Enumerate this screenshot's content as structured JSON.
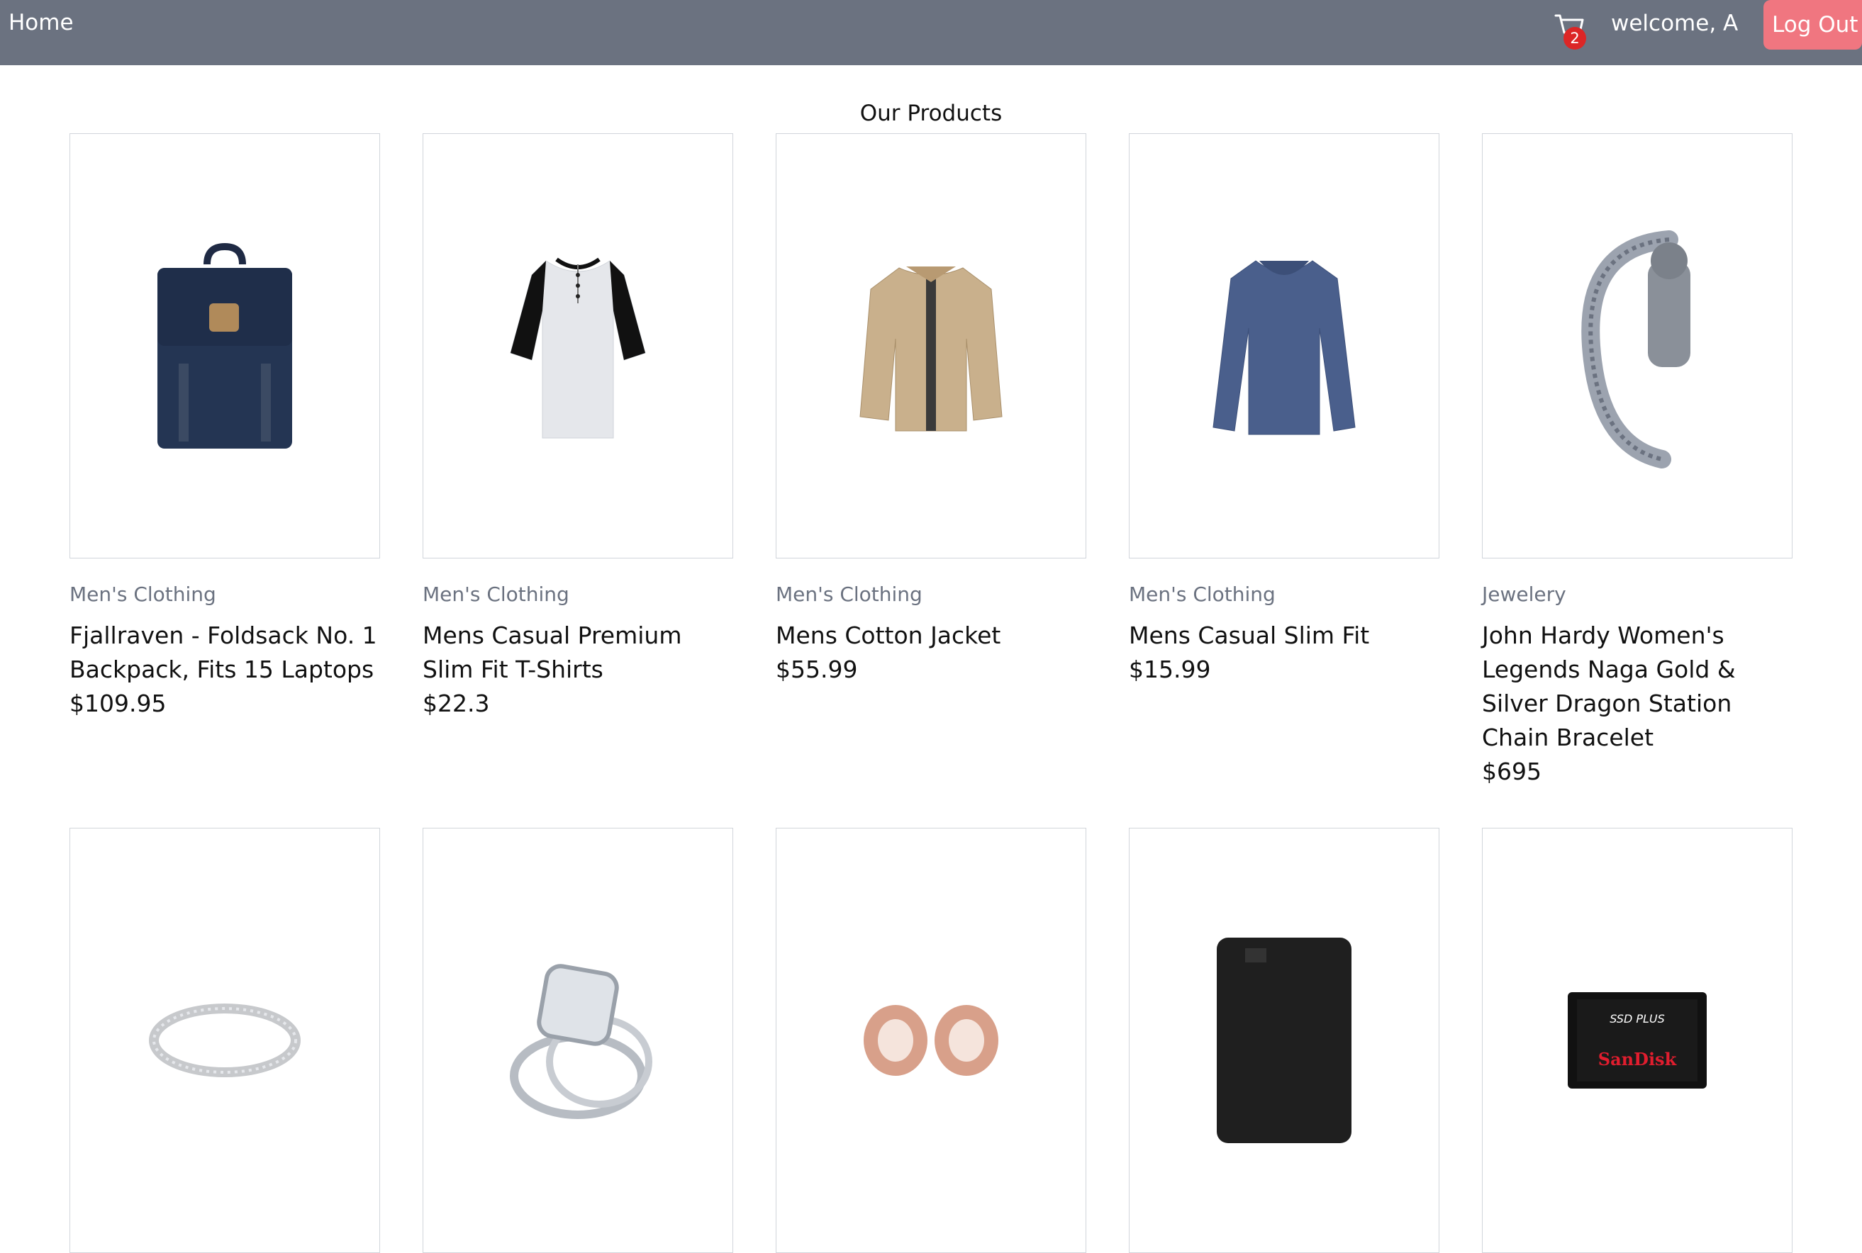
{
  "nav": {
    "home_label": "Home",
    "cart_count": "2",
    "welcome_text": "welcome, A",
    "logout_label": "Log Out"
  },
  "main": {
    "section_title": "Our Products",
    "products": [
      {
        "category": "Men's Clothing",
        "title": "Fjallraven - Foldsack No. 1 Backpack, Fits 15 Laptops",
        "price": "$109.95",
        "icon": "backpack-image"
      },
      {
        "category": "Men's Clothing",
        "title": "Mens Casual Premium Slim Fit T-Shirts",
        "price": "$22.3",
        "icon": "tshirt-image"
      },
      {
        "category": "Men's Clothing",
        "title": "Mens Cotton Jacket",
        "price": "$55.99",
        "icon": "jacket-image"
      },
      {
        "category": "Men's Clothing",
        "title": "Mens Casual Slim Fit",
        "price": "$15.99",
        "icon": "longsleeve-shirt-image"
      },
      {
        "category": "Jewelery",
        "title": "John Hardy Women's Legends Naga Gold & Silver Dragon Station Chain Bracelet",
        "price": "$695",
        "icon": "bracelet-image"
      },
      {
        "icon": "ring-image"
      },
      {
        "icon": "engagement-ring-image"
      },
      {
        "icon": "rose-gold-plugs-image"
      },
      {
        "icon": "external-drive-image"
      },
      {
        "icon": "ssd-image",
        "brand_line1": "SSD PLUS",
        "brand_line2": "SanDisk"
      }
    ]
  },
  "colors": {
    "header_bg": "#6b7280",
    "logout_bg": "#f07680",
    "badge_bg": "#dc2626"
  }
}
